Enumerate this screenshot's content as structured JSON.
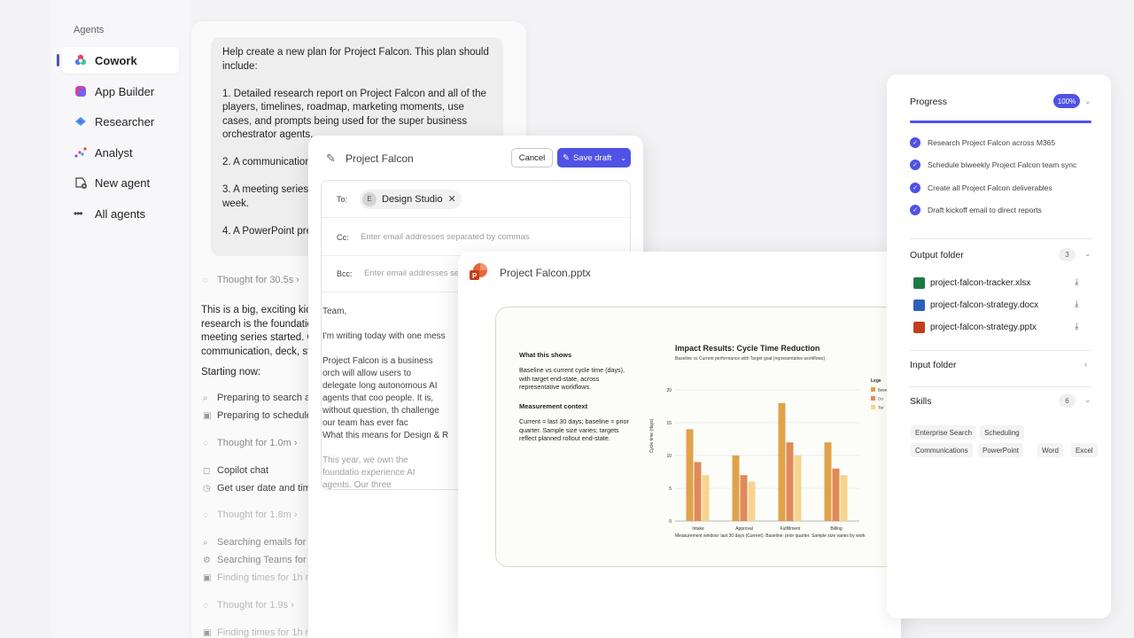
{
  "sidebar": {
    "title": "Agents",
    "items": [
      {
        "label": "Cowork",
        "icon": "cowork-icon"
      },
      {
        "label": "App Builder",
        "icon": "app-builder-icon"
      },
      {
        "label": "Researcher",
        "icon": "researcher-icon"
      },
      {
        "label": "Analyst",
        "icon": "analyst-icon"
      },
      {
        "label": "New agent",
        "icon": "new-agent-icon"
      },
      {
        "label": "All agents",
        "icon": "more-icon"
      }
    ]
  },
  "chat": {
    "prompt": "Help create a new plan for Project Falcon. This plan should include:\n\n1. Detailed research report on Project Falcon and all of the players, timelines, roadmap, marketing moments, use cases, and prompts being used for the super business orchestrator agents.\n\n2. A communication plan with a summary of the strategy\n\n3. A meeting series\nweek.\n\n4. A PowerPoint presentation",
    "thought1": "Thought for 30.5s",
    "response": "This is a big, exciting kick- research is the foundation meeting series started. C communication, deck, st",
    "starting": "Starting now:",
    "steps1": [
      "Preparing to search across",
      "Preparing to schedule m"
    ],
    "thought2": "Thought for 1.0m",
    "steps2": [
      "Copilot chat",
      "Get user date and time a"
    ],
    "thought3": "Thought for 1.8m",
    "steps3": [
      "Searching emails for \"Pr",
      "Searching Teams for \"Pr",
      "Finding times for 1h me"
    ],
    "thought4": "Thought for 1.9s",
    "steps4": [
      "Finding times for 1h me"
    ]
  },
  "email": {
    "title": "Project Falcon",
    "cancel": "Cancel",
    "save": "Save draft",
    "to_label": "To:",
    "recipient": "Design Studio",
    "recipient_initial": "E",
    "cc_label": "Cc:",
    "cc_placeholder": "Enter email addresses separated by commas",
    "bcc_label": "Bcc:",
    "bcc_placeholder": "Enter email addresses sepa",
    "greeting": "Team,",
    "p1": "I'm writing today with one mess",
    "p2": "Project Falcon is a business orch will allow users to delegate long autonomous AI agents that coo people. It is, without question, th challenge our team has ever fac",
    "p3": "What this means for Design & R",
    "p4": "This year, we own the foundatio experience AI agents. Our three"
  },
  "ppt": {
    "filename": "Project Falcon.pptx",
    "h1": "What this shows",
    "t1": "Baseline vs current cycle time (days), with target end-state, across representative workflows.",
    "h2": "Measurement context",
    "t2": "Current = last 30 days; baseline = prior quarter. Sample size varies; targets reflect planned rollout end-state."
  },
  "chart_data": {
    "type": "bar",
    "title": "Impact Results: Cycle Time Reduction",
    "subtitle": "Baseline vs Current performance with Target goal (representative workflows)",
    "ylabel": "Cycle time (days)",
    "xlabel": "",
    "ylim": [
      0,
      20
    ],
    "yticks": [
      0,
      5,
      10,
      15,
      20
    ],
    "categories": [
      "Intake",
      "Approval",
      "Fulfillment",
      "Billing"
    ],
    "series": [
      {
        "name": "Base",
        "values": [
          14,
          10,
          18,
          12
        ],
        "color": "#e0a24a"
      },
      {
        "name": "Cu",
        "values": [
          9,
          7,
          12,
          8
        ],
        "color": "#e08a58"
      },
      {
        "name": "Tar",
        "values": [
          7,
          6,
          10,
          7
        ],
        "color": "#f7d48e"
      }
    ],
    "legend_title": "Lege",
    "legend_position": "right",
    "footnote": "Measurement window: last 30 days (Current). Baseline: prior quarter. Sample size varies by work"
  },
  "progress": {
    "title": "Progress",
    "percent_label": "100%",
    "percent": 1.0,
    "steps": [
      "Research Project Falcon across M365",
      "Schedule biweekly Project Falcon team sync",
      "Create all Project Falcon deliverables",
      "Draft kickoff email to direct reports"
    ],
    "output_title": "Output folder",
    "output_count": "3",
    "files": [
      {
        "name": "project-falcon-tracker.xlsx",
        "color": "#1d7a45",
        "icon": "excel-file-icon"
      },
      {
        "name": "project-falcon-strategy.docx",
        "color": "#2b5fb8",
        "icon": "word-file-icon"
      },
      {
        "name": "project-falcon-strategy.pptx",
        "color": "#c43e1c",
        "icon": "powerpoint-file-icon"
      }
    ],
    "input_title": "Input folder",
    "skills_title": "Skills",
    "skills_count": "6",
    "skills": [
      "Enterprise Search",
      "Scheduling",
      "Communications",
      "PowerPoint",
      "Word",
      "Excel"
    ]
  },
  "colors": {
    "accent": "#4f52e4",
    "ppt_red": "#c43e1c"
  }
}
